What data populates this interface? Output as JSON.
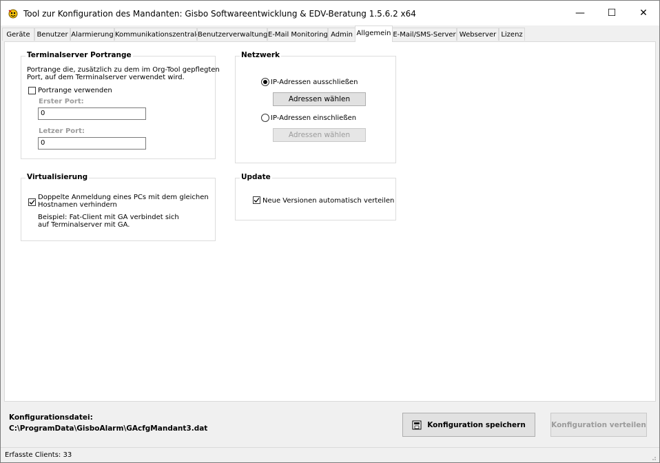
{
  "window": {
    "title": "Tool zur Konfiguration des Mandanten: Gisbo Softwareentwicklung & EDV-Beratung 1.5.6.2 x64",
    "minimize_glyph": "—",
    "maximize_glyph": "☐",
    "close_glyph": "✕"
  },
  "tabs": [
    {
      "label": "Geräte"
    },
    {
      "label": "Benutzer"
    },
    {
      "label": "Alarmierung"
    },
    {
      "label": "Kommunikationszentrale"
    },
    {
      "label": "Benutzerverwaltung"
    },
    {
      "label": "E-Mail Monitoring"
    },
    {
      "label": "Admin"
    },
    {
      "label": "Allgemein",
      "active": true
    },
    {
      "label": "E-Mail/SMS-Server"
    },
    {
      "label": "Webserver"
    },
    {
      "label": "Lizenz"
    }
  ],
  "terminal": {
    "title": "Terminalserver Portrange",
    "desc1": "Portrange die, zusätzlich zu dem im Org-Tool gepflegten",
    "desc2": "Port, auf dem Terminalserver verwendet wird.",
    "checkbox_label": "Portrange verwenden",
    "checked": false,
    "first_port_label": "Erster Port:",
    "first_port_value": "0",
    "last_port_label": "Letzer Port:",
    "last_port_value": "0"
  },
  "network": {
    "title": "Netzwerk",
    "exclude_label": "IP-Adressen ausschließen",
    "exclude_selected": true,
    "exclude_button": "Adressen wählen",
    "include_label": "IP-Adressen einschließen",
    "include_button": "Adressen wählen"
  },
  "virtualization": {
    "title": "Virtualisierung",
    "checkbox_line1": "Doppelte Anmeldung eines PCs mit dem gleichen",
    "checkbox_line2": "Hostnamen verhindern",
    "checked": true,
    "example_line1": "Beispiel: Fat-Client mit GA verbindet sich",
    "example_line2": "auf Terminalserver mit GA."
  },
  "update": {
    "title": "Update",
    "checkbox_label": "Neue Versionen automatisch verteilen",
    "checked": true
  },
  "footer": {
    "config_label": "Konfigurationsdatei:",
    "config_path": "C:\\ProgramData\\GisboAlarm\\GAcfgMandant3.dat",
    "save_button": "Konfiguration speichern",
    "distribute_button": "Konfiguration verteilen"
  },
  "status": {
    "clients_text": "Erfasste Clients: 33"
  },
  "colors": {
    "window_bg": "#f0f0f0",
    "content_bg": "#ffffff",
    "disabled_text": "#9b9b9b"
  }
}
